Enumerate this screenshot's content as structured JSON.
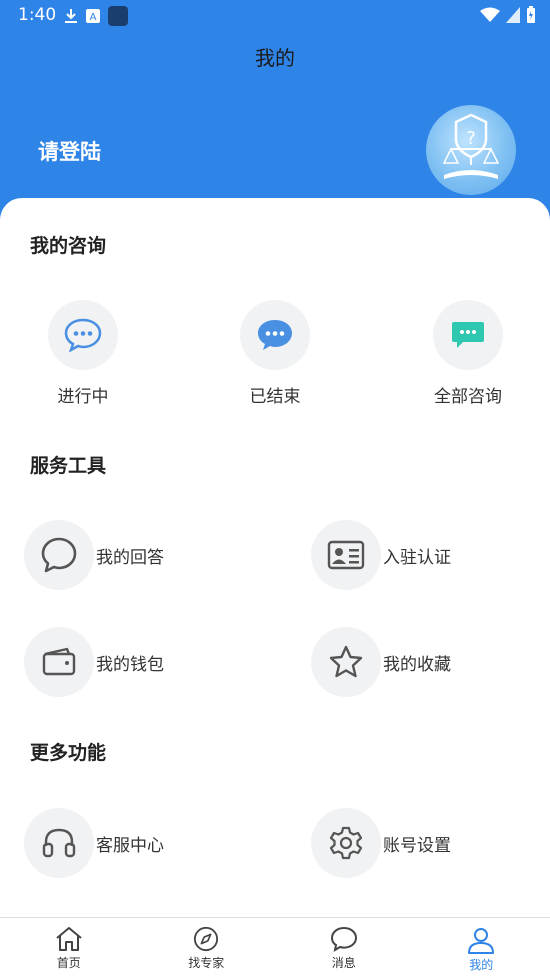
{
  "status": {
    "time": "1:40"
  },
  "header": {
    "title": "我的",
    "login_prompt": "请登陆"
  },
  "consult": {
    "title": "我的咨询",
    "items": [
      {
        "label": "进行中",
        "icon": "chat-bubble-outline-icon"
      },
      {
        "label": "已结束",
        "icon": "chat-bubble-filled-icon"
      },
      {
        "label": "全部咨询",
        "icon": "chat-bubble-green-icon"
      }
    ]
  },
  "tools": {
    "title": "服务工具",
    "items": [
      {
        "label": "我的回答",
        "icon": "comment-icon"
      },
      {
        "label": "入驻认证",
        "icon": "id-card-icon"
      },
      {
        "label": "我的钱包",
        "icon": "wallet-icon"
      },
      {
        "label": "我的收藏",
        "icon": "star-icon"
      }
    ]
  },
  "more": {
    "title": "更多功能",
    "items": [
      {
        "label": "客服中心",
        "icon": "headset-icon"
      },
      {
        "label": "账号设置",
        "icon": "settings-gear-icon"
      }
    ]
  },
  "tabs": [
    {
      "label": "首页",
      "icon": "home-icon"
    },
    {
      "label": "找专家",
      "icon": "compass-icon"
    },
    {
      "label": "消息",
      "icon": "message-icon"
    },
    {
      "label": "我的",
      "icon": "user-icon",
      "active": true
    }
  ],
  "colors": {
    "primary": "#2f84e8",
    "teal": "#2ec7b0"
  }
}
